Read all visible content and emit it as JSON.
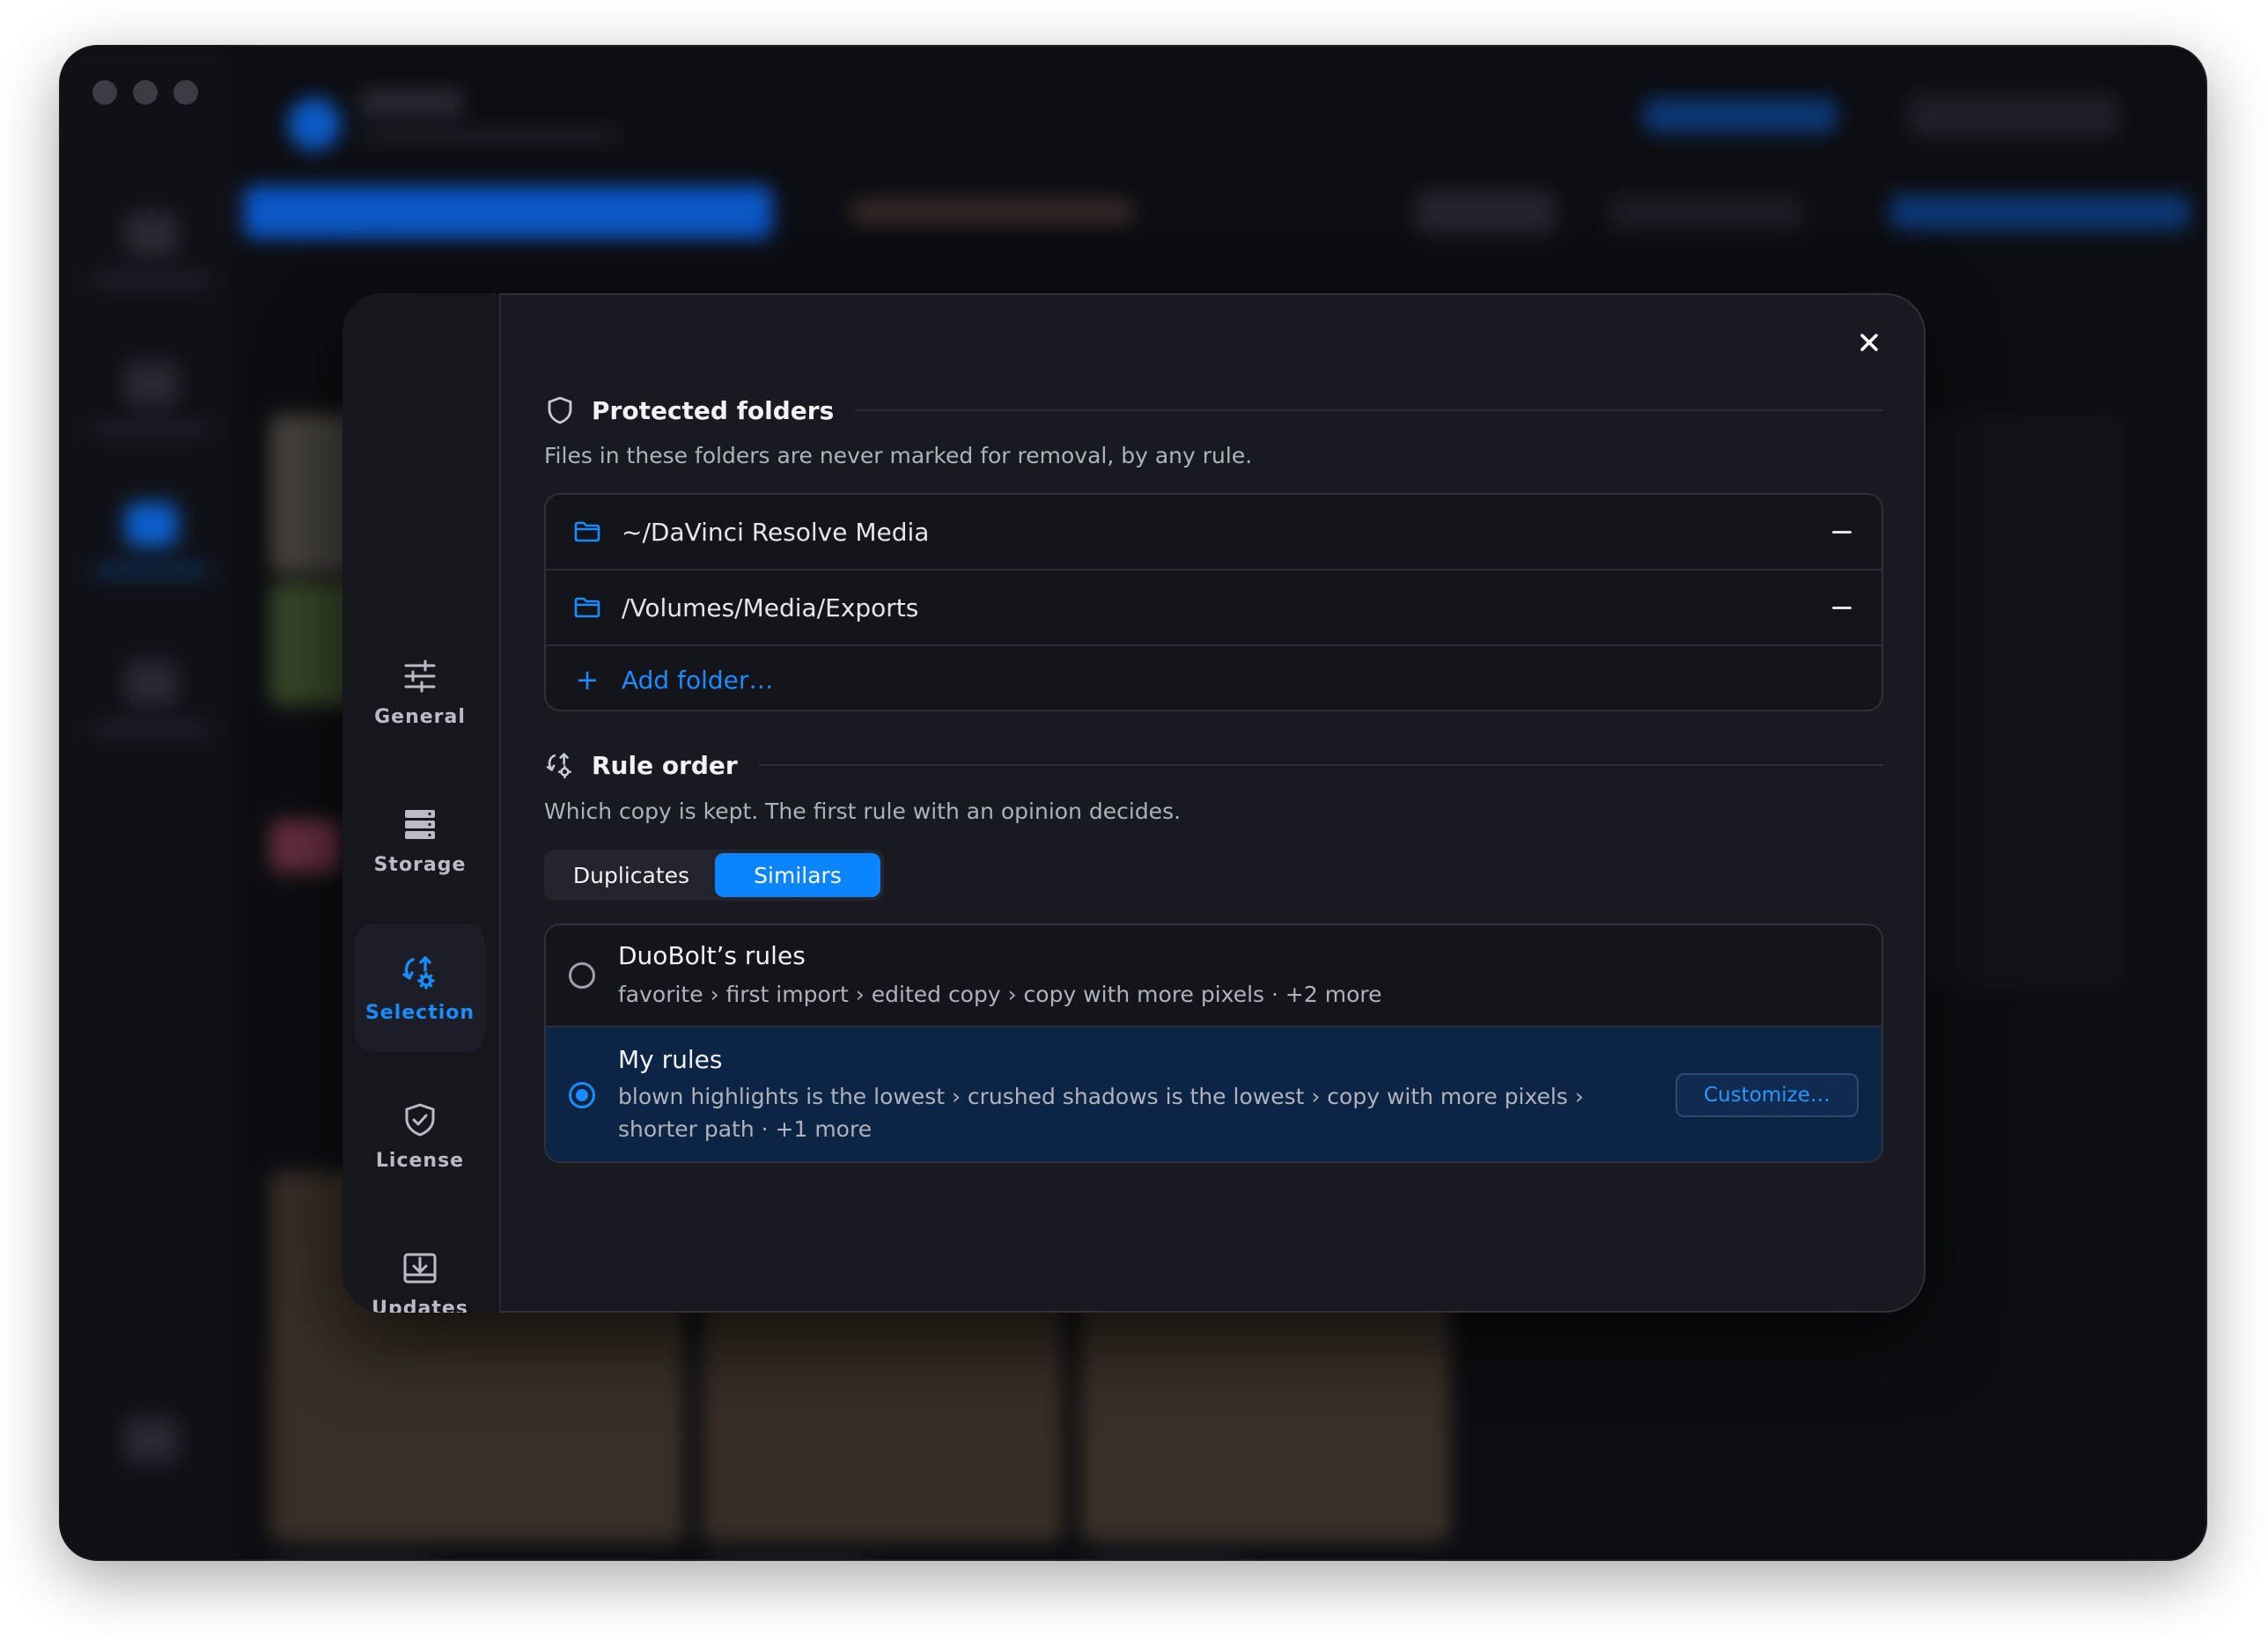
{
  "settings": {
    "nav": [
      {
        "label": "General",
        "icon": "sliders-icon"
      },
      {
        "label": "Storage",
        "icon": "storage-icon"
      },
      {
        "label": "Selection",
        "icon": "selection-icon",
        "active": true
      },
      {
        "label": "License",
        "icon": "shield-check-icon"
      },
      {
        "label": "Updates",
        "icon": "download-tray-icon"
      }
    ],
    "close_icon": "close-icon"
  },
  "protected": {
    "title": "Protected folders",
    "description": "Files in these folders are never marked for removal, by any rule.",
    "folders": [
      {
        "path": "~/DaVinci Resolve Media"
      },
      {
        "path": "/Volumes/Media/Exports"
      }
    ],
    "add_label": "Add folder…"
  },
  "rule_order": {
    "title": "Rule order",
    "description": "Which copy is kept. The first rule with an opinion decides.",
    "tabs": [
      {
        "label": "Duplicates",
        "selected": false
      },
      {
        "label": "Similars",
        "selected": true
      }
    ],
    "options": [
      {
        "name": "DuoBolt’s rules",
        "summary": "favorite › first import › edited copy › copy with more pixels · +2 more",
        "selected": false
      },
      {
        "name": "My rules",
        "summary": "blown highlights is the lowest › crushed shadows is the lowest › copy with more pixels › shorter path · +1 more",
        "selected": true
      }
    ],
    "customize_label": "Customize…"
  },
  "colors": {
    "accent": "#0a84ff",
    "modal_bg": "#181a21",
    "selected_row": "#0c2545"
  }
}
